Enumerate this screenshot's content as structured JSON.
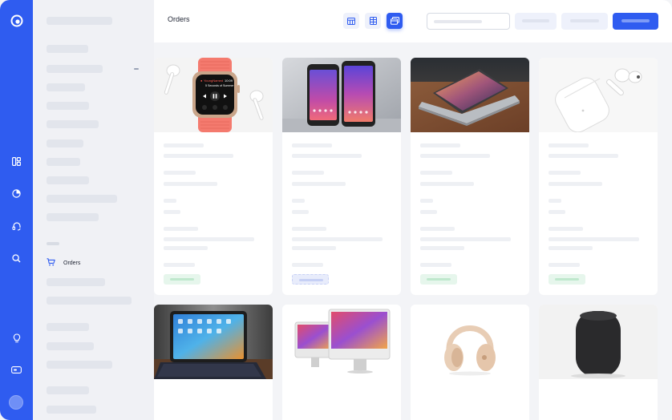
{
  "header": {
    "title": "Orders"
  },
  "sidebar": {
    "active_item_label": "Orders"
  },
  "view_modes": [
    "table-view",
    "grid-view",
    "card-view"
  ],
  "active_view": "card-view",
  "colors": {
    "accent": "#2f5cf0",
    "status_green": "#e6f6ec",
    "status_blue": "#e8ecfb"
  },
  "products": [
    {
      "name": "Apple Watch with AirPods",
      "status": "green"
    },
    {
      "name": "Google Pixel phones",
      "status": "blue"
    },
    {
      "name": "MacBook Pro",
      "status": "green"
    },
    {
      "name": "AirPods",
      "status": "green"
    },
    {
      "name": "iPad with keyboard",
      "status": ""
    },
    {
      "name": "iMac",
      "status": ""
    },
    {
      "name": "Beats headphones",
      "status": ""
    },
    {
      "name": "HomePod",
      "status": ""
    }
  ],
  "watch_screen": {
    "time": "10:09",
    "source": "YoungNamed",
    "track": "5 Seconds of Summer"
  }
}
